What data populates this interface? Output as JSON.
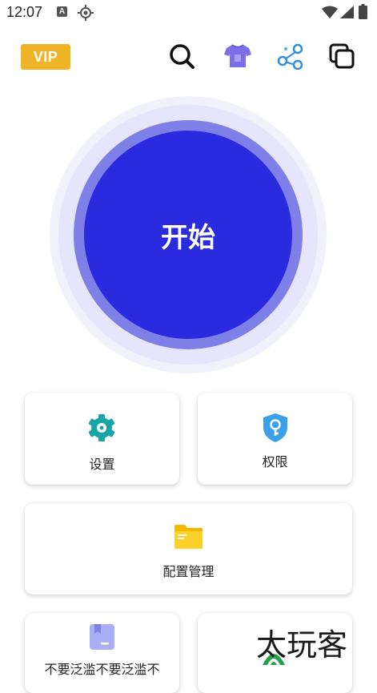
{
  "status_bar": {
    "time": "12:07",
    "notification_letter": "A"
  },
  "header": {
    "vip_label": "VIP",
    "accent_color": "#f0b429"
  },
  "start_button": {
    "label": "开始",
    "color": "#2a2adf"
  },
  "cards": {
    "settings_label": "设置",
    "permission_label": "权限",
    "config_label": "配置管理",
    "bottom_left_label": "不要泛滥不要泛滥不"
  },
  "watermark": {
    "text": "太玩客"
  },
  "icons": {
    "search": "search-icon",
    "theme": "tshirt-icon",
    "share": "share-icon",
    "window": "multi-window-icon",
    "settings": "gear-icon",
    "permission": "shield-key-icon",
    "config": "folder-icon",
    "bottom_left": "bookmark-icon"
  }
}
